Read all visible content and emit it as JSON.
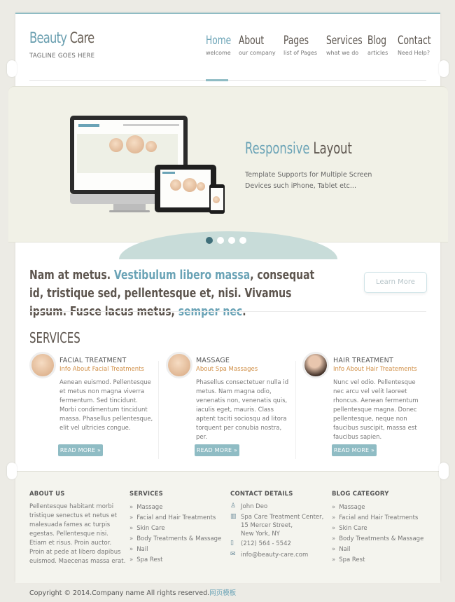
{
  "brand": {
    "name_part1": "Beauty",
    "name_part2": "Care",
    "tagline": "TAGLINE GOES HERE"
  },
  "nav": [
    {
      "label": "Home",
      "sub": "welcome",
      "active": true
    },
    {
      "label": "About",
      "sub": "our company"
    },
    {
      "label": "Pages",
      "sub": "list of Pages"
    },
    {
      "label": "Services",
      "sub": "what we do"
    },
    {
      "label": "Blog",
      "sub": "articles"
    },
    {
      "label": "Contact",
      "sub": "Need Help?"
    }
  ],
  "slider": {
    "heading_accent": "Responsive",
    "heading_rest": "Layout",
    "text": "Template Supports for Multiple Screen Devices such iPhone, Tablet etc...",
    "active_slide": 1,
    "slide_count": 4
  },
  "intro": {
    "p1": "Nam at metus. ",
    "p2": "Vestibulum libero massa",
    "p3": ", consequat id, tristique sed, pellentesque et, nisi. Vivamus ipsum. Fusce lacus metus, ",
    "p4": "semper nec",
    "p5": ".",
    "button": "Learn More"
  },
  "services": {
    "title": "SERVICES",
    "items": [
      {
        "title": "FACIAL TREATMENT",
        "sub": "Info About Facial Treatments",
        "body": "Aenean euismod. Pellentesque et metus non magna viverra fermentum. Sed tincidunt. Morbi condimentum tincidunt massa. Phasellus pellentesque, elit vel ultricies congue.",
        "button": "READ MORE »"
      },
      {
        "title": "MASSAGE",
        "sub": "About Spa Massages",
        "body": "Phasellus consectetuer nulla id metus. Nam magna odio, venenatis non, venenatis quis, iaculis eget, mauris. Class aptent taciti sociosqu ad litora torquent per conubia nostra, per.",
        "button": "READ MORE »"
      },
      {
        "title": "HAIR TREATMENT",
        "sub": "Info About Hair Treatements",
        "body": "Nunc vel odio. Pellentesque nec arcu vel velit laoreet rhoncus. Aenean fermentum pellentesque magna. Donec pellentesque, neque non faucibus suscipit, massa est faucibus sapien.",
        "button": "READ MORE »"
      }
    ]
  },
  "footer": {
    "about": {
      "title": "ABOUT US",
      "text": "Pellentesque habitant morbi tristique senectus et netus et malesuada fames ac turpis egestas. Pellentesque nisi. Etiam et risus. Proin auctor. Proin at pede at libero dapibus euismod. Maecenas massa erat."
    },
    "services": {
      "title": "SERVICES",
      "items": [
        "Massage",
        "Facial and Hair Treatments",
        "Skin Care",
        "Body Treatments & Massage",
        "Nail",
        "Spa Rest"
      ]
    },
    "contact": {
      "title": "CONTACT DETAILS",
      "name": "John Deo",
      "addr1": "Spa Care Treatment Center,",
      "addr2": "15 Mercer Street,",
      "addr3": "New York, NY",
      "phone": "(212) 564 - 5542",
      "email": "info@beauty-care.com"
    },
    "blog": {
      "title": "BLOG CATEGORY",
      "items": [
        "Massage",
        "Facial and Hair Treatments",
        "Skin Care",
        "Body Treatments & Massage",
        "Nail",
        "Spa Rest"
      ]
    }
  },
  "copyright": {
    "text": "Copyright © 2014.Company name All rights reserved.",
    "link": "网页模板"
  }
}
